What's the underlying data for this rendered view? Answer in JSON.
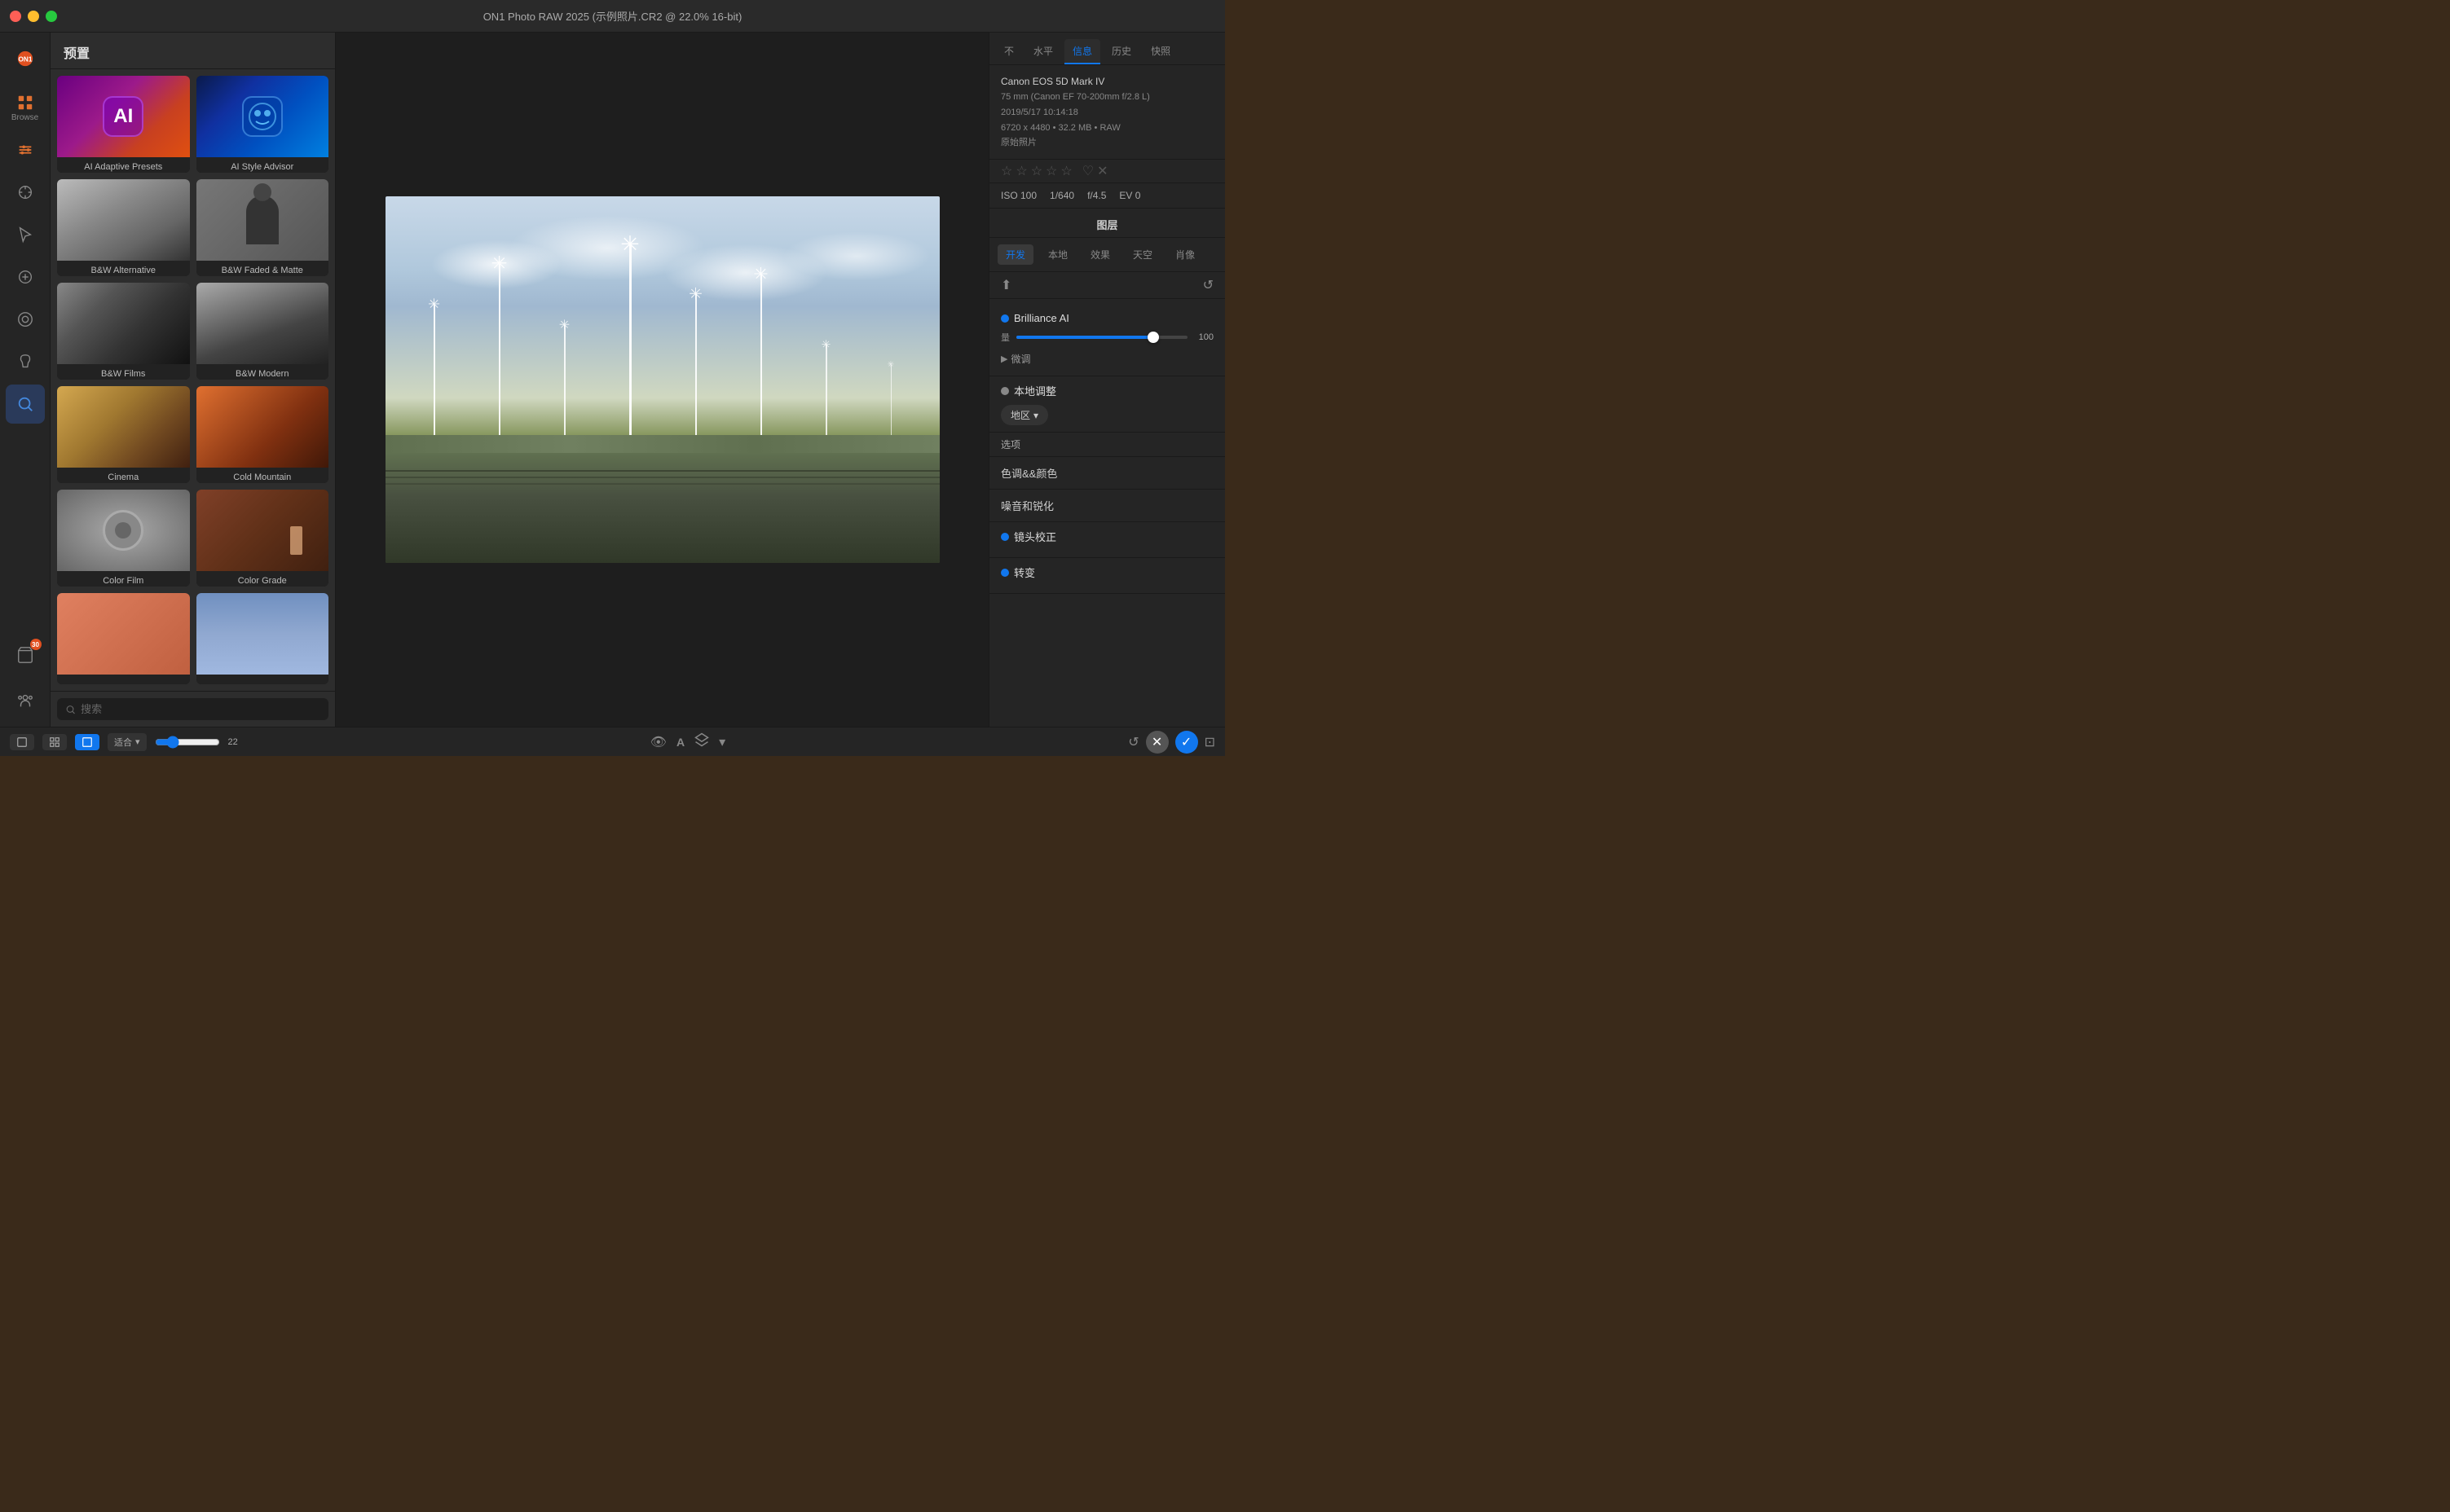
{
  "titlebar": {
    "title": "ON1 Photo RAW 2025 (示例照片.CR2 @ 22.0% 16-bit)",
    "close": "●",
    "min": "●",
    "max": "●"
  },
  "left_toolbar": {
    "items": [
      {
        "id": "browse",
        "label": "Browse",
        "icon": "grid"
      },
      {
        "id": "develop",
        "label": "Develop",
        "icon": "sliders",
        "active": true
      },
      {
        "id": "effects",
        "label": "Effects",
        "icon": "sparkles"
      },
      {
        "id": "select",
        "label": "Select",
        "icon": "wand"
      },
      {
        "id": "retouch",
        "label": "Retouch",
        "icon": "brush"
      },
      {
        "id": "focus",
        "label": "Focus",
        "icon": "circle"
      },
      {
        "id": "masking",
        "label": "Masking",
        "icon": "hand"
      },
      {
        "id": "search2",
        "label": "Search",
        "icon": "search"
      }
    ]
  },
  "presets_panel": {
    "title": "预置",
    "items": [
      {
        "id": "ai-adaptive",
        "label": "AI Adaptive Presets",
        "thumb_type": "ai-adaptive"
      },
      {
        "id": "ai-style",
        "label": "AI Style Advisor",
        "thumb_type": "ai-style"
      },
      {
        "id": "bw-alt",
        "label": "B&W Alternative",
        "thumb_type": "bw-alt"
      },
      {
        "id": "bw-faded",
        "label": "B&W Faded & Matte",
        "thumb_type": "bw-faded"
      },
      {
        "id": "bw-films",
        "label": "B&W Films",
        "thumb_type": "bw-films"
      },
      {
        "id": "bw-modern",
        "label": "B&W Modern",
        "thumb_type": "bw-modern"
      },
      {
        "id": "cinema",
        "label": "Cinema",
        "thumb_type": "cinema"
      },
      {
        "id": "cold-mountain",
        "label": "Cold Mountain",
        "thumb_type": "cold-mountain"
      },
      {
        "id": "color-film",
        "label": "Color Film",
        "thumb_type": "color-film"
      },
      {
        "id": "color-grade",
        "label": "Color Grade",
        "thumb_type": "color-grade"
      },
      {
        "id": "partial1",
        "label": "",
        "thumb_type": "partial1"
      },
      {
        "id": "partial2",
        "label": "",
        "thumb_type": "partial2"
      }
    ],
    "search_placeholder": "搜索"
  },
  "right_panel": {
    "tabs": [
      "不",
      "水平",
      "信息",
      "历史",
      "快照"
    ],
    "active_tab": "信息",
    "camera_info": {
      "model": "Canon EOS 5D Mark IV",
      "lens": "75 mm (Canon EF 70-200mm f/2.8 L)",
      "datetime": "2019/5/17  10:14:18",
      "resolution": "6720 x 4480 • 32.2 MB • RAW",
      "original": "原始照片"
    },
    "exposure": {
      "iso": "ISO 100",
      "shutter": "1/640",
      "aperture": "f/4.5",
      "ev": "EV 0"
    },
    "layers_title": "图层",
    "develop_tabs": [
      "开发",
      "本地",
      "效果",
      "天空",
      "肖像"
    ],
    "active_develop_tab": "开发",
    "sections": [
      {
        "id": "brilliance-ai",
        "title": "Brilliance AI",
        "has_dot": true,
        "dot_color": "#1177ee",
        "slider_label": "量",
        "slider_value": 100,
        "slider_pct": 100,
        "microtune_label": "微调"
      },
      {
        "id": "local-adjust",
        "title": "本地调整",
        "has_dot": true,
        "dot_color": "#888",
        "region_label": "地区"
      },
      {
        "id": "options",
        "title": "选项"
      },
      {
        "id": "tone-color",
        "title": "色调&&颜色"
      },
      {
        "id": "noise-sharpen",
        "title": "噪音和锐化"
      },
      {
        "id": "lens-correct",
        "title": "镜头校正",
        "has_dot": true,
        "dot_color": "#1177ee"
      },
      {
        "id": "transform",
        "title": "转变",
        "has_dot": true,
        "dot_color": "#1177ee"
      }
    ]
  },
  "bottom_bar": {
    "fit_label": "适合",
    "zoom_value": "100",
    "zoom_display": "22",
    "view_modes": [
      "grid",
      "film",
      "single"
    ],
    "tools": [
      "eye",
      "letter-a",
      "layers"
    ]
  }
}
